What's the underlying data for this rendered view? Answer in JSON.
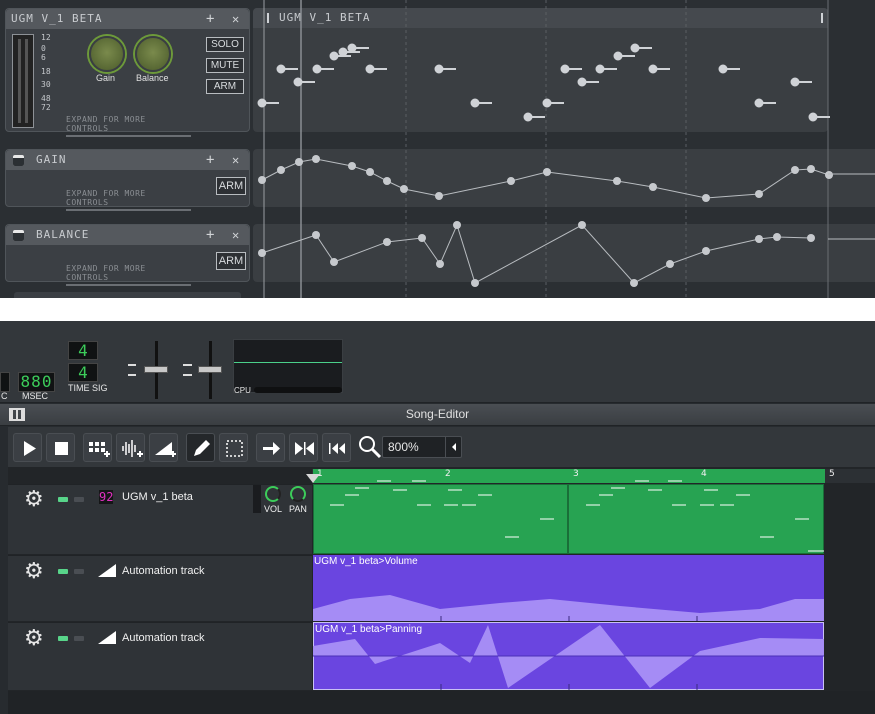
{
  "instrument": {
    "name": "UGM V_1 BETA",
    "plus_icon": "+",
    "close_icon": "✕",
    "solo": "SOLO",
    "mute": "MUTE",
    "arm": "ARM",
    "gain_label": "Gain",
    "balance_label": "Balance",
    "expand": "EXPAND FOR MORE CONTROLS",
    "meter_scale": [
      "12",
      "0",
      "6",
      "18",
      "30",
      "48",
      "72"
    ]
  },
  "gain_track": {
    "title": "GAIN",
    "arm": "ARM",
    "expand": "EXPAND FOR MORE CONTROLS",
    "plus_icon": "+",
    "close_icon": "✕"
  },
  "balance_track": {
    "title": "BALANCE",
    "arm": "ARM",
    "expand": "EXPAND FOR MORE CONTROLS",
    "plus_icon": "+",
    "close_icon": "✕"
  },
  "pattern_lane": {
    "title": "UGM V_1 BETA"
  },
  "transport": {
    "msec_label": "MSEC",
    "msec_value": "880",
    "c_label": "C",
    "timesig_label": "TIME SIG",
    "timesig_num": "4",
    "timesig_den": "4",
    "cpu_label": "CPU"
  },
  "song_editor": {
    "title": "Song-Editor",
    "zoom": "800%",
    "bars": [
      "1",
      "2",
      "3",
      "4",
      "5"
    ]
  },
  "tracks": [
    {
      "lcd": "92",
      "name": "UGM v_1 beta",
      "vol_label": "VOL",
      "pan_label": "PAN"
    },
    {
      "name": "Automation track",
      "clip": "UGM v_1 beta>Volume"
    },
    {
      "name": "Automation track",
      "clip": "UGM v_1 beta>Panning"
    }
  ],
  "colors": {
    "green": "#28a653",
    "clip_green": "#27a352",
    "purple": "#6a45e0",
    "purple_fill": "#a58cf5",
    "lcd_green": "#3ccc5a",
    "lcd_magenta": "#e030c0"
  }
}
